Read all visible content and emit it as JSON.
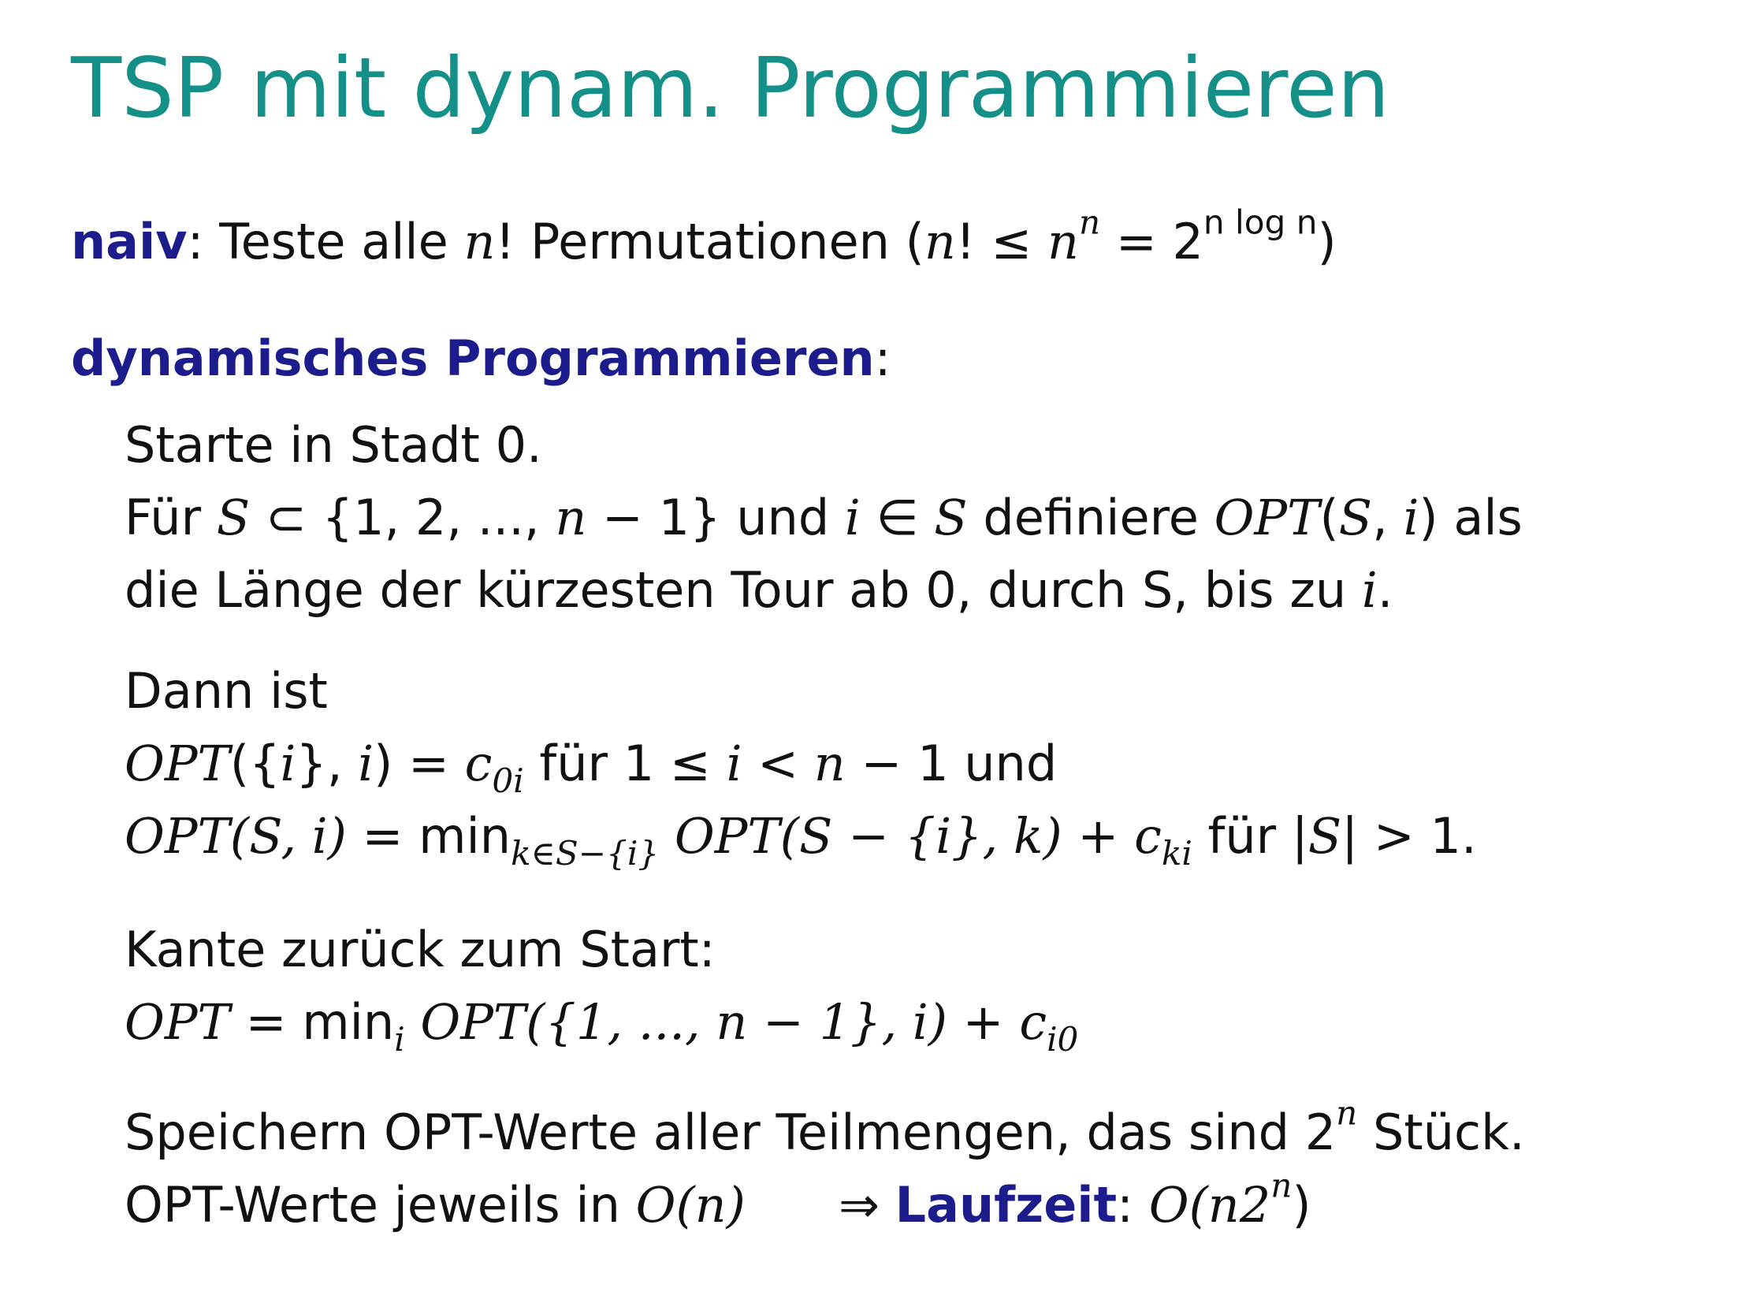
{
  "title": "TSP mit dynam. Programmieren",
  "naiv": {
    "label": "naiv",
    "colon": ":",
    "text_before": " Teste alle ",
    "var_n": "n",
    "text_after": "! Permutationen ",
    "formula_open": "(",
    "formula_n": "n",
    "formula_middle": "! ≤ ",
    "formula_n2": "n",
    "formula_sup_n": "n",
    "formula_eq": " = 2",
    "formula_sup": "n log n",
    "formula_close": ")"
  },
  "dp": {
    "label": "dynamisches Programmieren",
    "colon": ":"
  },
  "block1": {
    "line1": "Starte in Stadt 0.",
    "line2_pre": "Für ",
    "line2_S": "S",
    "line2_set": " ⊂ {1, 2, ..., ",
    "line2_n": "n",
    "line2_setclose": " − 1} und ",
    "line2_i": "i",
    "line2_in": " ∈ ",
    "line2_S2": "S",
    "line2_def": " definiere ",
    "line2_opt": "OPT",
    "line2_args_open": "(",
    "line2_argS": "S",
    "line2_comma": ", ",
    "line2_argi": "i",
    "line2_args_close": ")",
    "line2_post": " als",
    "line3_pre": "die Länge der kürzesten Tour ab 0, durch S, bis zu ",
    "line3_i": "i",
    "line3_post": "."
  },
  "block2": {
    "line1": "Dann ist",
    "l2_opt": "OPT",
    "l2_mid": "({",
    "l2_i": "i",
    "l2_mid2": "}, ",
    "l2_i2": "i",
    "l2_eq": ") = ",
    "l2_c": "c",
    "l2_sub": "0i",
    "l2_text": " für 1 ≤ ",
    "l2_i3": "i",
    "l2_lt": " < ",
    "l2_n": "n",
    "l2_end": " − 1 und",
    "l3_opt": "OPT",
    "l3_args": "(S, i)",
    "l3_eq": " = min",
    "l3_sub": "k∈S−{i}",
    "l3_opt2": " OPT",
    "l3_args2": "(S − {i}, k)",
    "l3_plus": " + ",
    "l3_c": "c",
    "l3_csub": "ki",
    "l3_text": " für |",
    "l3_S": "S",
    "l3_end": "| > 1."
  },
  "block3": {
    "line1": "Kante zurück zum Start:",
    "l2_opt": "OPT",
    "l2_eq": " = min",
    "l2_sub": "i",
    "l2_opt2": " OPT",
    "l2_args": "({1, ..., n − 1}, i)",
    "l2_plus": " + ",
    "l2_c": "c",
    "l2_csub": "i0"
  },
  "block4": {
    "line1_pre": "Speichern OPT-Werte aller Teilmengen, das sind 2",
    "line1_sup": "n",
    "line1_post": " Stück.",
    "line2_pre": "OPT-Werte jeweils in ",
    "line2_O": "O",
    "line2_arg": "(n)",
    "line2_arrow": "      ⇒ ",
    "line2_kw": "Laufzeit",
    "line2_colon": ": ",
    "line2_O2": "O",
    "line2_arg2_open": "(n2",
    "line2_sup": "n",
    "line2_arg2_close": ")"
  },
  "colors": {
    "title": "#149088",
    "keyword": "#1c1c8c",
    "text": "#111111"
  }
}
